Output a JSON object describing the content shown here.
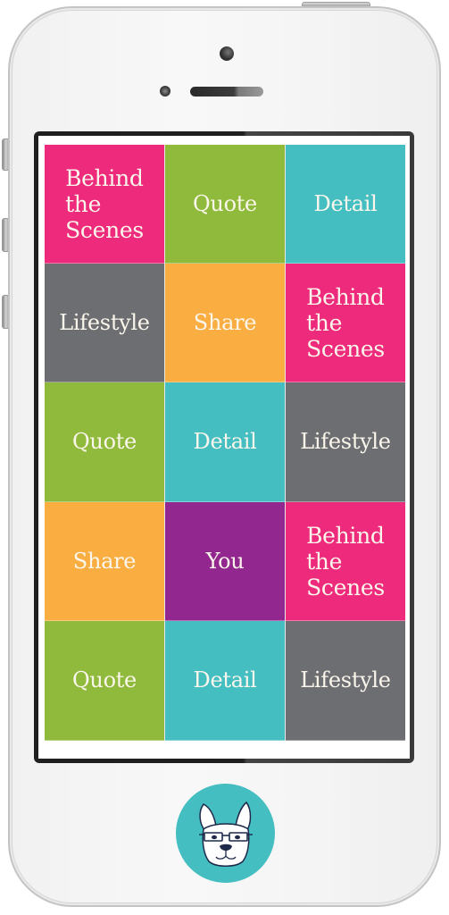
{
  "device": {
    "type": "smartphone-mockup",
    "body_color": "#f6f6f6",
    "bezel_color": "#1f1f1f"
  },
  "screen": {
    "tiles": [
      {
        "label": "Behind\nthe\nScenes",
        "color": "#ed2a7b"
      },
      {
        "label": "Quote",
        "color": "#8fba3b"
      },
      {
        "label": "Detail",
        "color": "#45bec2"
      },
      {
        "label": "Lifestyle",
        "color": "#6d6e71"
      },
      {
        "label": "Share",
        "color": "#faad40"
      },
      {
        "label": "Behind\nthe\nScenes",
        "color": "#ed2a7b"
      },
      {
        "label": "Quote",
        "color": "#8fba3b"
      },
      {
        "label": "Detail",
        "color": "#45bec2"
      },
      {
        "label": "Lifestyle",
        "color": "#6d6e71"
      },
      {
        "label": "Share",
        "color": "#faad40"
      },
      {
        "label": "You",
        "color": "#92278f"
      },
      {
        "label": "Behind\nthe\nScenes",
        "color": "#ed2a7b"
      },
      {
        "label": "Quote",
        "color": "#8fba3b"
      },
      {
        "label": "Detail",
        "color": "#45bec2"
      },
      {
        "label": "Lifestyle",
        "color": "#6d6e71"
      }
    ]
  },
  "home_button": {
    "icon": "french-bulldog-with-glasses-icon",
    "color": "#45bec2"
  }
}
